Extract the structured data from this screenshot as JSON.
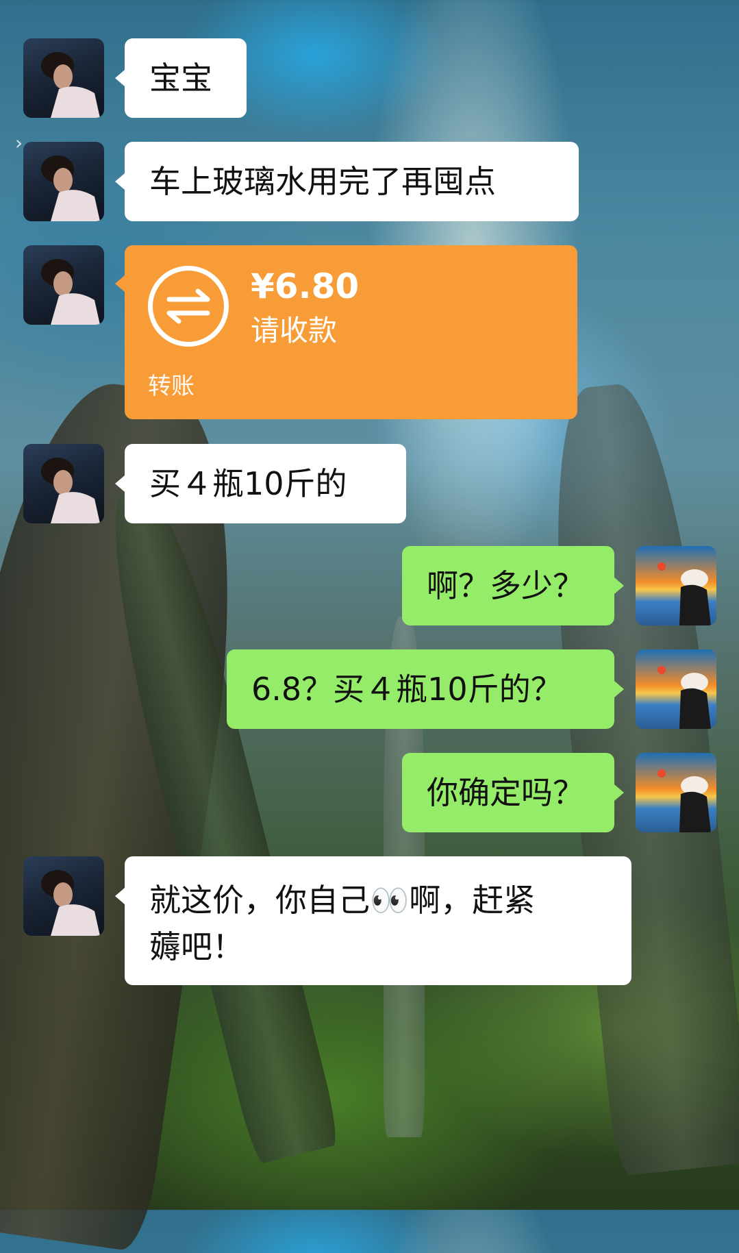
{
  "background": {
    "scene": "forest-sunrays"
  },
  "contacts": {
    "other": {
      "avatar_icon": "avatar-male-photo"
    },
    "me": {
      "avatar_icon": "avatar-female-sunset-photo"
    }
  },
  "messages": [
    {
      "from": "other",
      "type": "text",
      "text": "宝宝"
    },
    {
      "from": "other",
      "type": "text",
      "text": "车上玻璃水用完了再囤点"
    },
    {
      "from": "other",
      "type": "transfer",
      "amount": "¥6.80",
      "status": "请收款",
      "label": "转账",
      "icon": "transfer-arrows-icon",
      "color": "#f89c37"
    },
    {
      "from": "other",
      "type": "text",
      "text": "买４瓶10斤的"
    },
    {
      "from": "me",
      "type": "text",
      "text": "啊？多少？"
    },
    {
      "from": "me",
      "type": "text",
      "text": "6.8？买４瓶10斤的？"
    },
    {
      "from": "me",
      "type": "text",
      "text": "你确定吗？"
    },
    {
      "from": "other",
      "type": "text",
      "text_line1": "就这价，你自己",
      "emoji": "👀",
      "text_line1_end": "啊，赶紧",
      "text_line2": "薅吧！"
    }
  ],
  "colors": {
    "incoming_bubble": "#ffffff",
    "outgoing_bubble": "#95ec69",
    "transfer_card": "#f89c37"
  }
}
